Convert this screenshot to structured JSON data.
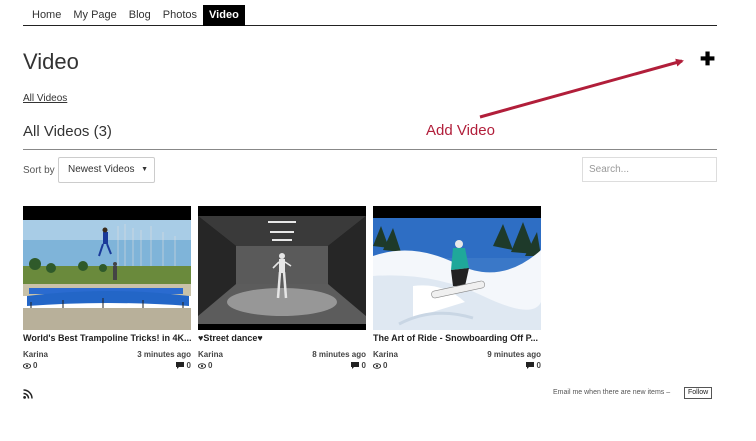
{
  "nav": {
    "items": [
      {
        "label": "Home"
      },
      {
        "label": "My Page"
      },
      {
        "label": "Blog"
      },
      {
        "label": "Photos"
      },
      {
        "label": "Video",
        "active": true
      }
    ]
  },
  "page": {
    "title": "Video",
    "add_icon": "plus-icon",
    "breadcrumb": "All Videos"
  },
  "annotation": {
    "label": "Add Video",
    "color": "#b11e3a"
  },
  "section": {
    "title": "All Videos (3)"
  },
  "controls": {
    "sort_label": "Sort by",
    "sort_value": "Newest Videos",
    "search_placeholder": "Search..."
  },
  "videos": [
    {
      "title": "World's Best Trampoline Tricks! in 4K...",
      "author": "Karina",
      "time": "3 minutes ago",
      "views": "0",
      "comments": "0"
    },
    {
      "title": "♥Street dance♥",
      "author": "Karina",
      "time": "8 minutes ago",
      "views": "0",
      "comments": "0"
    },
    {
      "title": "The Art of Ride - Snowboarding Off P...",
      "author": "Karina",
      "time": "9 minutes ago",
      "views": "0",
      "comments": "0"
    }
  ],
  "footer": {
    "rss_icon": "rss-icon",
    "email_text": "Email me when there are new items –",
    "follow_label": "Follow"
  }
}
